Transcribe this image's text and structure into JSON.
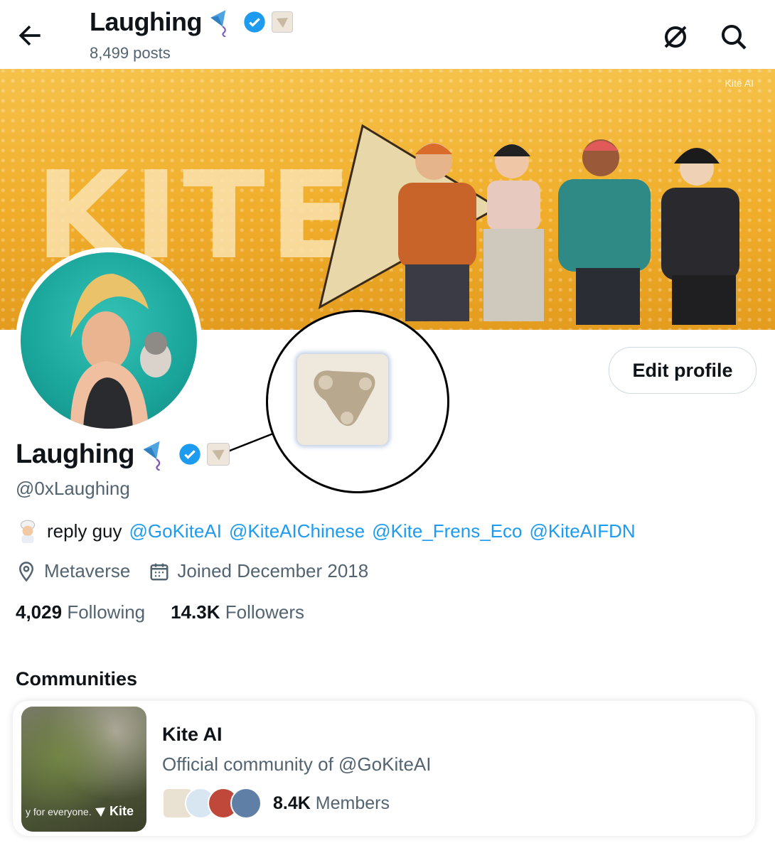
{
  "header": {
    "title": "Laughing",
    "post_count": "8,499 posts"
  },
  "banner": {
    "text": "KITE",
    "logo_text": "Kite AI"
  },
  "profile": {
    "edit_button": "Edit profile",
    "display_name": "Laughing",
    "handle": "@0xLaughing",
    "bio_text": "reply guy",
    "bio_mentions": [
      "@GoKiteAI",
      "@KiteAIChinese",
      "@Kite_Frens_Eco",
      "@KiteAIFDN"
    ],
    "location": "Metaverse",
    "joined": "Joined December 2018",
    "following_count": "4,029",
    "following_label": "Following",
    "followers_count": "14.3K",
    "followers_label": "Followers"
  },
  "communities": {
    "title": "Communities",
    "card": {
      "name": "Kite AI",
      "description": "Official community of @GoKiteAI",
      "image_caption": "y for everyone.",
      "image_logo": "Kite",
      "member_count": "8.4K",
      "member_label": "Members"
    }
  },
  "colors": {
    "accent": "#1d9bf0",
    "secondary_text": "#536471",
    "banner": "#f0ad2a",
    "avatar_bg": "#1aa59b"
  },
  "icons": [
    "back-arrow-icon",
    "grok-icon",
    "search-icon",
    "kite-emoji-icon",
    "verified-badge-icon",
    "affiliate-badge-icon",
    "location-icon",
    "calendar-icon",
    "chef-emoji-icon"
  ]
}
